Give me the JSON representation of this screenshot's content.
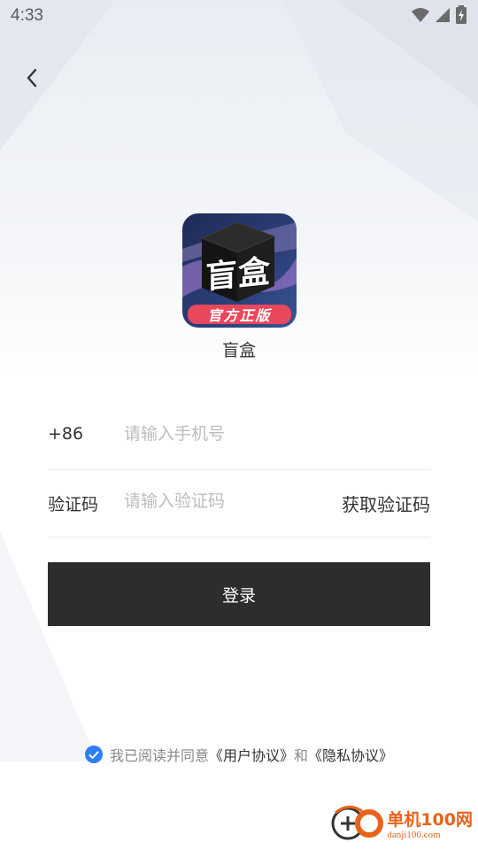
{
  "status_bar": {
    "time": "4:33",
    "icons": [
      "wifi-icon",
      "signal-icon",
      "battery-charging-icon"
    ]
  },
  "nav": {
    "back_icon": "chevron-left-icon"
  },
  "app": {
    "logo_text": "盲盒",
    "logo_badge": "官方正版",
    "name": "盲盒"
  },
  "form": {
    "phone_prefix": "+86",
    "phone_placeholder": "请输入手机号",
    "phone_value": "",
    "code_label": "验证码",
    "code_placeholder": "请输入验证码",
    "code_value": "",
    "get_code_label": "获取验证码"
  },
  "login_button": {
    "label": "登录",
    "background": "#2d2d2d"
  },
  "agreement": {
    "checked": true,
    "prefix": "我已阅读并同意",
    "user_agreement": "《用户协议》",
    "and": "和",
    "privacy_agreement": "《隐私协议》",
    "check_color": "#2f7cf6"
  },
  "watermark": {
    "site_name": "单机100网",
    "url": "danji100.com",
    "color": "#e8621a"
  }
}
